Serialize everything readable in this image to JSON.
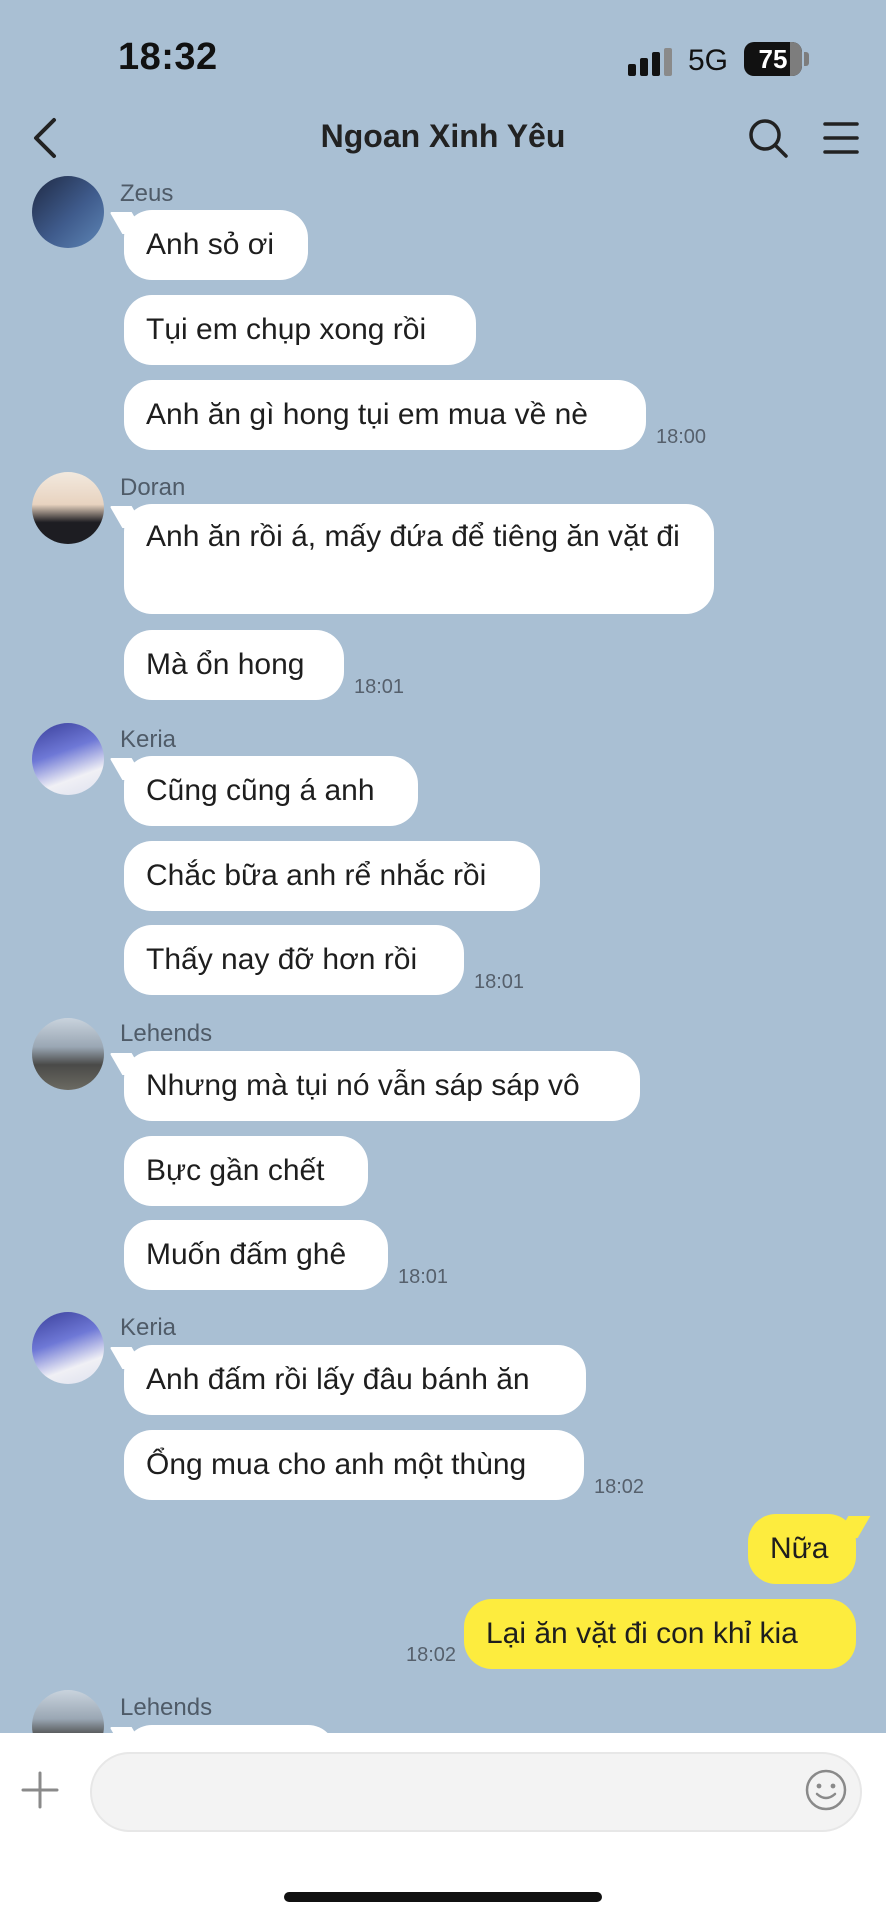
{
  "status": {
    "time": "18:32",
    "network": "5G",
    "battery": "75"
  },
  "header": {
    "title": "Ngoan Xinh Yêu"
  },
  "messages": [
    {
      "sender": "Zeus",
      "bubbles": [
        "Anh sỏ ơi",
        "Tụi em chụp xong rồi",
        "Anh ăn gì hong tụi em mua về nè"
      ],
      "time": "18:00"
    },
    {
      "sender": "Doran",
      "bubbles": [
        "Anh ăn rồi á, mấy đứa để tiêng ăn vặt đi",
        "Mà ổn hong"
      ],
      "time": "18:01"
    },
    {
      "sender": "Keria",
      "bubbles": [
        "Cũng cũng á anh",
        "Chắc bữa anh rể nhắc rồi",
        "Thấy nay đỡ hơn rồi"
      ],
      "time": "18:01"
    },
    {
      "sender": "Lehends",
      "bubbles": [
        "Nhưng mà tụi nó vẫn sáp sáp vô",
        "Bực gần chết",
        "Muốn đấm ghê"
      ],
      "time": "18:01"
    },
    {
      "sender": "Keria",
      "bubbles": [
        "Anh đấm rồi lấy đâu bánh ăn",
        "Ổng mua cho anh một thùng"
      ],
      "time": "18:02"
    },
    {
      "sender": "me",
      "bubbles": [
        "Nữa",
        "Lại ăn vặt đi con khỉ kia"
      ],
      "time": "18:02"
    },
    {
      "sender": "Lehends",
      "bubbles": []
    }
  ],
  "input": {
    "placeholder": ""
  },
  "icons": {
    "back": "chevron-left-icon",
    "search": "search-icon",
    "menu": "hamburger-menu-icon",
    "plus": "plus-icon",
    "emoji": "smiley-icon"
  },
  "colors": {
    "background": "#a9bfd3",
    "incoming_bubble": "#ffffff",
    "outgoing_bubble": "#fdec3e"
  }
}
